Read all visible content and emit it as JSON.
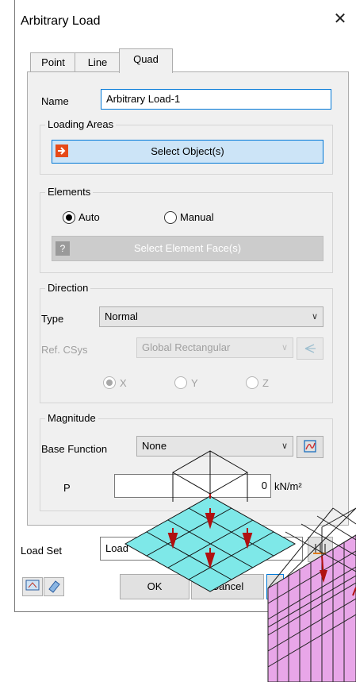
{
  "window": {
    "title": "Arbitrary Load",
    "close_glyph": "✕"
  },
  "tabs": [
    {
      "label": "Point"
    },
    {
      "label": "Line"
    },
    {
      "label": "Quad"
    }
  ],
  "name": {
    "label": "Name",
    "value": "Arbitrary Load-1"
  },
  "loading_areas": {
    "label": "Loading Areas",
    "select_button": "Select Object(s)"
  },
  "elements": {
    "label": "Elements",
    "auto_label": "Auto",
    "manual_label": "Manual",
    "selected": "Auto",
    "select_face_button": "Select Element Face(s)",
    "help_glyph": "?"
  },
  "direction": {
    "label": "Direction",
    "type_label": "Type",
    "type_value": "Normal",
    "refcsys_label": "Ref. CSys",
    "refcsys_value": "Global Rectangular",
    "axis_x": "X",
    "axis_y": "Y",
    "axis_z": "Z",
    "selected_axis": "X"
  },
  "magnitude": {
    "label": "Magnitude",
    "base_function_label": "Base Function",
    "base_function_value": "None",
    "p_label": "P",
    "p_value": "0",
    "p_unit": "kN/m²"
  },
  "load_set": {
    "label": "Load Set",
    "value": "Load"
  },
  "footer": {
    "ok_label": "OK",
    "cancel_label": "Cancel"
  },
  "colors": {
    "select_button_bg": "#cce4f7",
    "select_button_border": "#0078d7",
    "quad_fill": "#7ee8e8",
    "solid_fill": "#e8a6e8",
    "arrow": "#b01010"
  }
}
